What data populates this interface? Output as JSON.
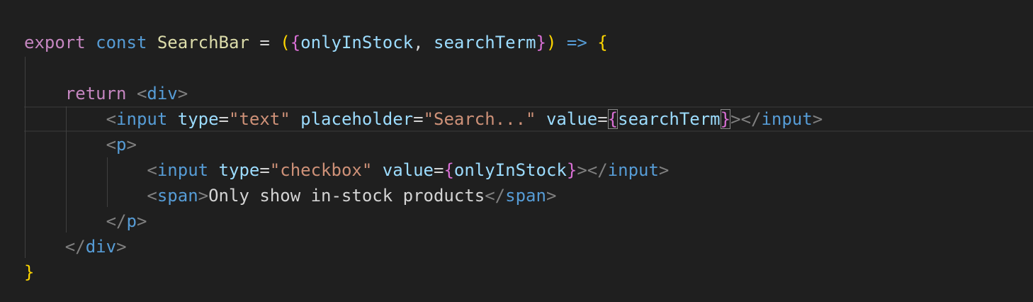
{
  "editor": {
    "lines": [
      {
        "tokens": [
          {
            "text": "export",
            "type": "keyword-control"
          },
          {
            "text": " ",
            "type": "plain"
          },
          {
            "text": "const",
            "type": "keyword"
          },
          {
            "text": " ",
            "type": "plain"
          },
          {
            "text": "SearchBar",
            "type": "function"
          },
          {
            "text": " = ",
            "type": "plain"
          },
          {
            "text": "(",
            "type": "bracket-yellow"
          },
          {
            "text": "{",
            "type": "bracket-pink"
          },
          {
            "text": "onlyInStock",
            "type": "variable"
          },
          {
            "text": ", ",
            "type": "plain"
          },
          {
            "text": "searchTerm",
            "type": "variable"
          },
          {
            "text": "}",
            "type": "bracket-pink"
          },
          {
            "text": ")",
            "type": "bracket-yellow"
          },
          {
            "text": " ",
            "type": "plain"
          },
          {
            "text": "=>",
            "type": "keyword"
          },
          {
            "text": " ",
            "type": "plain"
          },
          {
            "text": "{",
            "type": "bracket-yellow"
          }
        ]
      },
      {
        "tokens": []
      },
      {
        "tokens": [
          {
            "text": "    ",
            "type": "plain"
          },
          {
            "text": "return",
            "type": "keyword-control"
          },
          {
            "text": " ",
            "type": "plain"
          },
          {
            "text": "<",
            "type": "punct"
          },
          {
            "text": "div",
            "type": "tag"
          },
          {
            "text": ">",
            "type": "punct"
          }
        ]
      },
      {
        "tokens": [
          {
            "text": "        ",
            "type": "plain"
          },
          {
            "text": "<",
            "type": "punct"
          },
          {
            "text": "input",
            "type": "tag"
          },
          {
            "text": " ",
            "type": "plain"
          },
          {
            "text": "type",
            "type": "variable"
          },
          {
            "text": "=",
            "type": "plain"
          },
          {
            "text": "\"text\"",
            "type": "string"
          },
          {
            "text": " ",
            "type": "plain"
          },
          {
            "text": "placeholder",
            "type": "variable"
          },
          {
            "text": "=",
            "type": "plain"
          },
          {
            "text": "\"Search...\"",
            "type": "string"
          },
          {
            "text": " ",
            "type": "plain"
          },
          {
            "text": "value",
            "type": "variable"
          },
          {
            "text": "=",
            "type": "plain"
          },
          {
            "text": "{",
            "type": "bracket-pink",
            "match": true
          },
          {
            "text": "searchTerm",
            "type": "variable"
          },
          {
            "text": "}",
            "type": "bracket-pink",
            "match": true
          },
          {
            "text": "></",
            "type": "punct"
          },
          {
            "text": "input",
            "type": "tag"
          },
          {
            "text": ">",
            "type": "punct"
          }
        ]
      },
      {
        "tokens": [
          {
            "text": "        ",
            "type": "plain"
          },
          {
            "text": "<",
            "type": "punct"
          },
          {
            "text": "p",
            "type": "tag"
          },
          {
            "text": ">",
            "type": "punct"
          }
        ]
      },
      {
        "tokens": [
          {
            "text": "            ",
            "type": "plain"
          },
          {
            "text": "<",
            "type": "punct"
          },
          {
            "text": "input",
            "type": "tag"
          },
          {
            "text": " ",
            "type": "plain"
          },
          {
            "text": "type",
            "type": "variable"
          },
          {
            "text": "=",
            "type": "plain"
          },
          {
            "text": "\"checkbox\"",
            "type": "string"
          },
          {
            "text": " ",
            "type": "plain"
          },
          {
            "text": "value",
            "type": "variable"
          },
          {
            "text": "=",
            "type": "plain"
          },
          {
            "text": "{",
            "type": "bracket-pink"
          },
          {
            "text": "onlyInStock",
            "type": "variable"
          },
          {
            "text": "}",
            "type": "bracket-pink"
          },
          {
            "text": "></",
            "type": "punct"
          },
          {
            "text": "input",
            "type": "tag"
          },
          {
            "text": ">",
            "type": "punct"
          }
        ]
      },
      {
        "tokens": [
          {
            "text": "            ",
            "type": "plain"
          },
          {
            "text": "<",
            "type": "punct"
          },
          {
            "text": "span",
            "type": "tag"
          },
          {
            "text": ">",
            "type": "punct"
          },
          {
            "text": "Only show in-stock products",
            "type": "plain"
          },
          {
            "text": "</",
            "type": "punct"
          },
          {
            "text": "span",
            "type": "tag"
          },
          {
            "text": ">",
            "type": "punct"
          }
        ]
      },
      {
        "tokens": [
          {
            "text": "        ",
            "type": "plain"
          },
          {
            "text": "</",
            "type": "punct"
          },
          {
            "text": "p",
            "type": "tag"
          },
          {
            "text": ">",
            "type": "punct"
          }
        ]
      },
      {
        "tokens": [
          {
            "text": "    ",
            "type": "plain"
          },
          {
            "text": "</",
            "type": "punct"
          },
          {
            "text": "div",
            "type": "tag"
          },
          {
            "text": ">",
            "type": "punct"
          }
        ]
      },
      {
        "tokens": [
          {
            "text": "}",
            "type": "bracket-yellow"
          }
        ]
      }
    ],
    "colors": {
      "background": "#1f1f1f",
      "keyword-control": "#c586c0",
      "keyword": "#569cd6",
      "function": "#dcdcaa",
      "variable": "#9cdcfe",
      "string": "#ce9178",
      "tag": "#569cd6",
      "punct": "#808080",
      "plain": "#d4d4d4",
      "bracket-yellow": "#ffd700",
      "bracket-pink": "#da70d6",
      "indent-guide": "#404040"
    }
  }
}
